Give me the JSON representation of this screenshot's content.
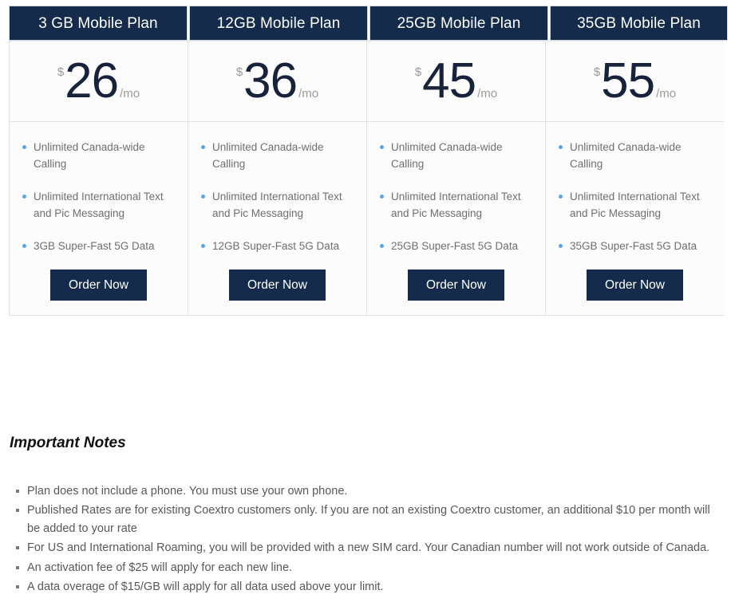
{
  "colors": {
    "header_navy": "#142b4c",
    "button_navy": "#142b4c",
    "bullet_blue": "#59a7e0",
    "price_text": "#16233a",
    "muted_gray": "#9a9a9a",
    "feature_text": "#6f6f6f",
    "note_text": "#585858",
    "cell_bg": "#fcfcfc",
    "border_gray": "#e2e2e2"
  },
  "plans": [
    {
      "header": "3 GB Mobile Plan",
      "currency": "$",
      "price": "26",
      "period": "/mo",
      "features": [
        "Unlimited Canada-wide Calling",
        "Unlimited International Text and Pic Messaging",
        "3GB Super-Fast 5G Data"
      ],
      "cta": "Order Now"
    },
    {
      "header": "12GB Mobile Plan",
      "currency": "$",
      "price": "36",
      "period": "/mo",
      "features": [
        "Unlimited Canada-wide Calling",
        "Unlimited International Text and Pic Messaging",
        "12GB Super-Fast 5G Data"
      ],
      "cta": "Order Now"
    },
    {
      "header": "25GB Mobile Plan",
      "currency": "$",
      "price": "45",
      "period": "/mo",
      "features": [
        "Unlimited Canada-wide Calling",
        "Unlimited International Text and Pic Messaging",
        "25GB Super-Fast 5G Data"
      ],
      "cta": "Order Now"
    },
    {
      "header": "35GB Mobile Plan",
      "currency": "$",
      "price": "55",
      "period": "/mo",
      "features": [
        "Unlimited Canada-wide Calling",
        "Unlimited International Text and Pic Messaging",
        "35GB Super-Fast 5G Data"
      ],
      "cta": "Order Now"
    }
  ],
  "notes": {
    "title": "Important Notes",
    "items": [
      "Plan does not include a phone. You must use your own phone.",
      "Published Rates are for existing Coextro customers only. If you are not an existing Coextro customer, an additional $10 per month will be added to your rate",
      "For US and International Roaming, you will be provided with a new SIM card. Your Canadian number will not work outside of Canada.",
      "An activation fee of $25 will apply for each new line.",
      "A data overage of $15/GB will apply for all data used above your limit."
    ]
  }
}
